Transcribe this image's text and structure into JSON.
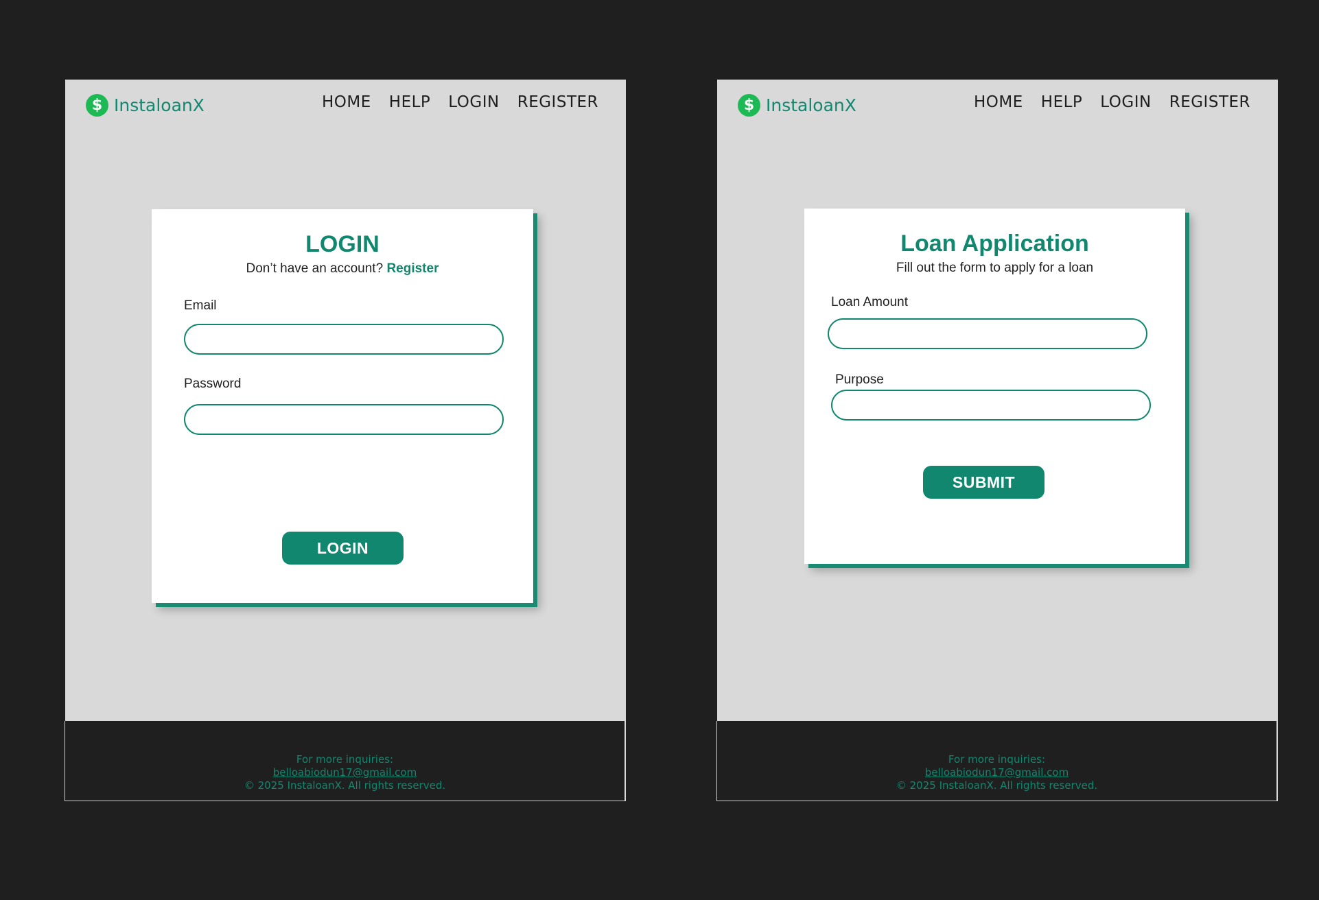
{
  "colors": {
    "accent": "#12876f",
    "brand_icon": "#1db954",
    "frame_bg": "#d9d9d9",
    "outer_bg": "#1f1f1f",
    "card_bg": "#ffffff"
  },
  "brand": {
    "icon": "dollar-icon",
    "symbol": "$",
    "name": "InstaloanX"
  },
  "nav": {
    "home": "HOME",
    "help": "HELP",
    "login": "LOGIN",
    "register": "REGISTER"
  },
  "login_page": {
    "title": "LOGIN",
    "subtitle_prefix": "Don’t have an account?",
    "subtitle_link": "Register",
    "email_label": "Email",
    "email_value": "",
    "password_label": "Password",
    "password_value": "",
    "submit_label": "LOGIN"
  },
  "loan_page": {
    "title": "Loan Application",
    "subtitle": "Fill out the form to apply for a loan",
    "amount_label": "Loan Amount",
    "amount_value": "",
    "purpose_label": "Purpose",
    "purpose_value": "",
    "submit_label": "SUBMIT"
  },
  "footer": {
    "line1": "For more inquiries:",
    "email": "belloabiodun17@gmail.com",
    "copyright": "© 2025 InstaloanX. All rights reserved."
  }
}
